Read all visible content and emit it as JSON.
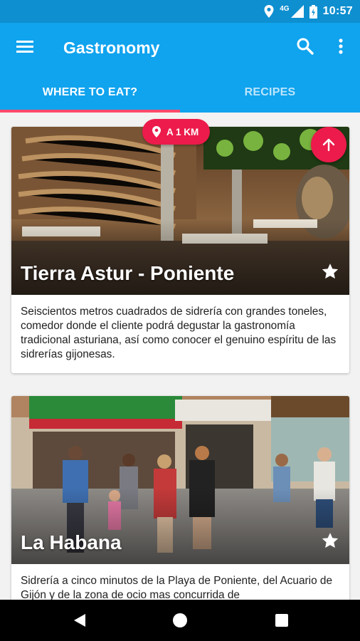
{
  "status_bar": {
    "network": "4G",
    "time": "10:57"
  },
  "app_bar": {
    "title": "Gastronomy"
  },
  "tabs": [
    {
      "label": "WHERE TO EAT?",
      "selected": true
    },
    {
      "label": "RECIPES",
      "selected": false
    }
  ],
  "distance_badge": {
    "text": "A 1 KM"
  },
  "cards": [
    {
      "title": "Tierra Astur - Poniente",
      "description": "Seiscientos metros cuadrados de sidrería con grandes toneles, comedor donde el cliente podrá degustar la gastronomía tradicional asturiana, así como conocer el genuino espíritu de las sidrerías gijonesas."
    },
    {
      "title": "La Habana",
      "description": "Sidrería a cinco minutos de la Playa de Poniente, del Acuario de Gijón y de la zona de ocio mas concurrida de"
    }
  ],
  "colors": {
    "status_bar": "#0e8fd0",
    "app_bar": "#10a3ee",
    "accent": "#ec1b4b",
    "tab_indicator": "#ff4b6b"
  },
  "icons": [
    "menu-icon",
    "search-icon",
    "more-vert-icon",
    "location-pin-icon",
    "arrow-up-icon",
    "star-icon",
    "nav-back-icon",
    "nav-home-icon",
    "nav-recents-icon",
    "wifi-icon",
    "signal-icon",
    "battery-icon",
    "location-icon"
  ]
}
